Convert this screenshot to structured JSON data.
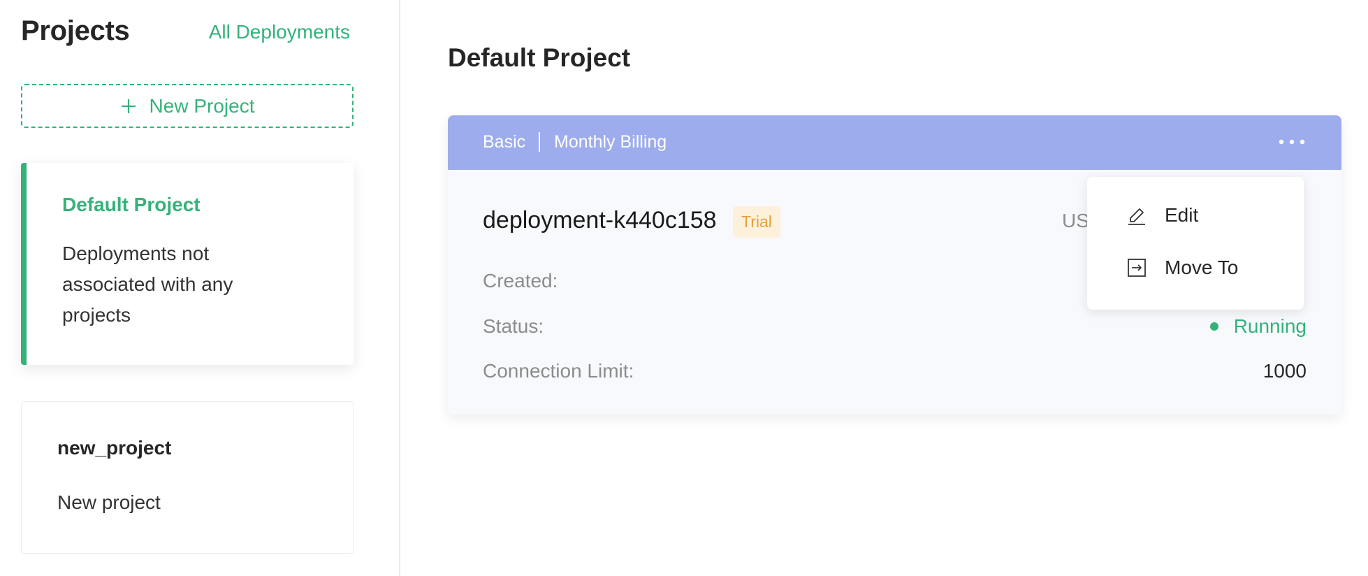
{
  "sidebar": {
    "title": "Projects",
    "all_deployments_link": "All Deployments",
    "new_project_label": "New Project",
    "projects": [
      {
        "name": "Default Project",
        "description": "Deployments not associated with any projects",
        "active": true
      },
      {
        "name": "new_project",
        "description": "New project",
        "active": false
      }
    ]
  },
  "main": {
    "title": "Default Project",
    "deployment": {
      "plan": "Basic",
      "billing": "Monthly Billing",
      "name": "deployment-k440c158",
      "badge": "Trial",
      "region_partial": "US",
      "created_label": "Created:",
      "status_label": "Status:",
      "status_value": "Running",
      "connection_limit_label": "Connection Limit:",
      "connection_limit_value": "1000"
    },
    "dropdown": {
      "edit_label": "Edit",
      "move_to_label": "Move To"
    }
  },
  "colors": {
    "accent": "#34b27a",
    "header": "#9daced",
    "trial_bg": "#fdf1dc",
    "trial_text": "#e5a13c"
  },
  "icons": {
    "plus": "plus-icon",
    "more": "more-horizontal-icon",
    "edit": "pencil-icon",
    "move": "move-to-icon"
  }
}
